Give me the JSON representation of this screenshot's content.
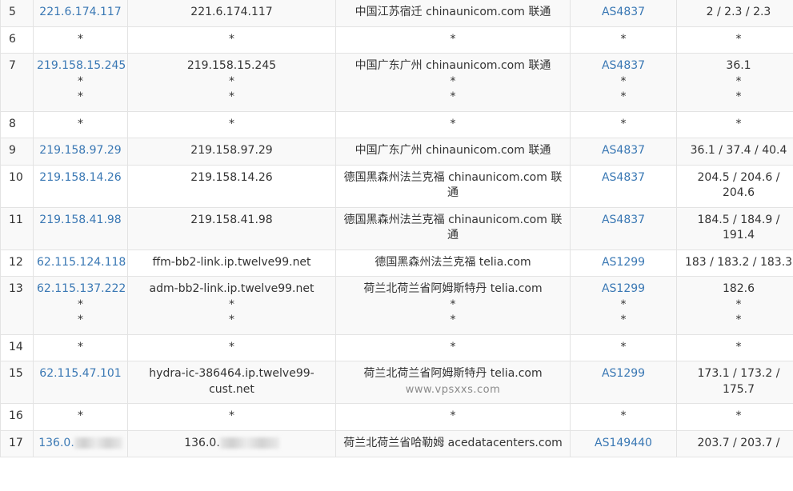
{
  "hops": [
    {
      "hop": "5",
      "ip": [
        "221.6.174.117"
      ],
      "host": [
        "221.6.174.117"
      ],
      "loc": [
        "中国江苏宿迁 chinaunicom.com 联通"
      ],
      "asn": [
        "AS4837"
      ],
      "time": [
        "2 / 2.3 / 2.3"
      ]
    },
    {
      "hop": "6",
      "ip": [
        "*"
      ],
      "host": [
        "*"
      ],
      "loc": [
        "*"
      ],
      "asn": [
        "*"
      ],
      "time": [
        "*"
      ]
    },
    {
      "hop": "7",
      "ip": [
        "219.158.15.245",
        "*",
        "*"
      ],
      "host": [
        "219.158.15.245",
        "*",
        "*"
      ],
      "loc": [
        "中国广东广州 chinaunicom.com 联通",
        "*",
        "*"
      ],
      "asn": [
        "AS4837",
        "*",
        "*"
      ],
      "time": [
        "36.1",
        "*",
        "*"
      ]
    },
    {
      "hop": "8",
      "ip": [
        "*"
      ],
      "host": [
        "*"
      ],
      "loc": [
        "*"
      ],
      "asn": [
        "*"
      ],
      "time": [
        "*"
      ]
    },
    {
      "hop": "9",
      "ip": [
        "219.158.97.29"
      ],
      "host": [
        "219.158.97.29"
      ],
      "loc": [
        "中国广东广州 chinaunicom.com 联通"
      ],
      "asn": [
        "AS4837"
      ],
      "time": [
        "36.1 / 37.4 / 40.4"
      ]
    },
    {
      "hop": "10",
      "ip": [
        "219.158.14.26"
      ],
      "host": [
        "219.158.14.26"
      ],
      "loc": [
        "德国黑森州法兰克福 chinaunicom.com 联通"
      ],
      "asn": [
        "AS4837"
      ],
      "time": [
        "204.5 / 204.6 / 204.6"
      ]
    },
    {
      "hop": "11",
      "ip": [
        "219.158.41.98"
      ],
      "host": [
        "219.158.41.98"
      ],
      "loc": [
        "德国黑森州法兰克福 chinaunicom.com 联通"
      ],
      "asn": [
        "AS4837"
      ],
      "time": [
        "184.5 / 184.9 / 191.4"
      ]
    },
    {
      "hop": "12",
      "ip": [
        "62.115.124.118"
      ],
      "host": [
        "ffm-bb2-link.ip.twelve99.net"
      ],
      "loc": [
        "德国黑森州法兰克福 telia.com"
      ],
      "asn": [
        "AS1299"
      ],
      "time": [
        "183 / 183.2 / 183.3"
      ]
    },
    {
      "hop": "13",
      "ip": [
        "62.115.137.222",
        "*",
        "*"
      ],
      "host": [
        "adm-bb2-link.ip.twelve99.net",
        "*",
        "*"
      ],
      "loc": [
        "荷兰北荷兰省阿姆斯特丹 telia.com",
        "*",
        "*"
      ],
      "asn": [
        "AS1299",
        "*",
        "*"
      ],
      "time": [
        "182.6",
        "*",
        "*"
      ]
    },
    {
      "hop": "14",
      "ip": [
        "*"
      ],
      "host": [
        "*"
      ],
      "loc": [
        "*"
      ],
      "asn": [
        "*"
      ],
      "time": [
        "*"
      ]
    },
    {
      "hop": "15",
      "ip": [
        "62.115.47.101"
      ],
      "host": [
        "hydra-ic-386464.ip.twelve99-cust.net"
      ],
      "loc": [
        "荷兰北荷兰省阿姆斯特丹 telia.com"
      ],
      "asn": [
        "AS1299"
      ],
      "time": [
        "173.1 / 173.2 / 175.7"
      ],
      "watermark": "www.vpsxxs.com"
    },
    {
      "hop": "16",
      "ip": [
        "*"
      ],
      "host": [
        "*"
      ],
      "loc": [
        "*"
      ],
      "asn": [
        "*"
      ],
      "time": [
        "*"
      ]
    },
    {
      "hop": "17",
      "ip": [
        "136.0."
      ],
      "host": [
        "136.0."
      ],
      "loc": [
        "荷兰北荷兰省哈勒姆 acedatacenters.com"
      ],
      "asn": [
        "AS149440"
      ],
      "time": [
        "203.7 / 203.7 /"
      ],
      "redacted": true
    }
  ]
}
